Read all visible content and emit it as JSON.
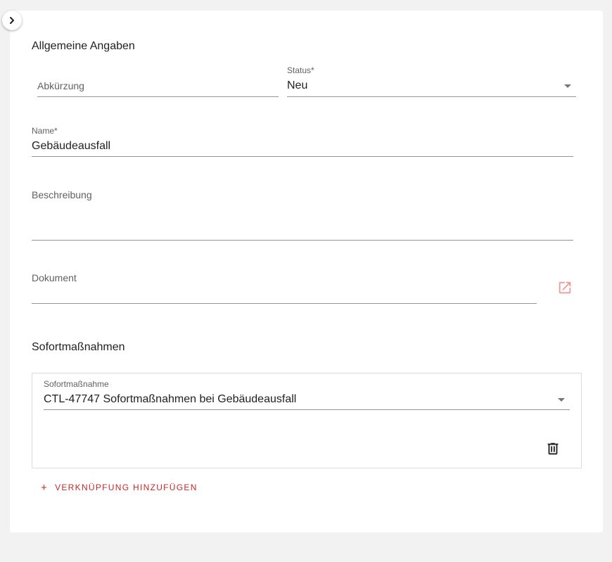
{
  "sections": {
    "general": "Allgemeine Angaben",
    "measures": "Sofortmaßnahmen"
  },
  "fields": {
    "abbreviation": {
      "label": "Abkürzung",
      "value": ""
    },
    "status": {
      "label": "Status*",
      "value": "Neu"
    },
    "name": {
      "label": "Name*",
      "value": "Gebäudeausfall"
    },
    "description": {
      "label": "Beschreibung",
      "value": ""
    },
    "document": {
      "label": "Dokument",
      "value": ""
    }
  },
  "measure_item": {
    "label": "Sofortmaßnahme",
    "value": "CTL-47747 Sofortmaßnahmen bei Gebäudeausfall"
  },
  "add_link": {
    "plus": "+",
    "label": "VERKNÜPFUNG HINZUFÜGEN"
  },
  "colors": {
    "accent": "#c62828",
    "background": "#f2f2f2",
    "card": "#ffffff"
  },
  "icons": {
    "toggle": "chevron-right-icon",
    "external": "open-in-new-icon",
    "delete": "trash-icon",
    "dropdown": "caret-down-icon"
  }
}
